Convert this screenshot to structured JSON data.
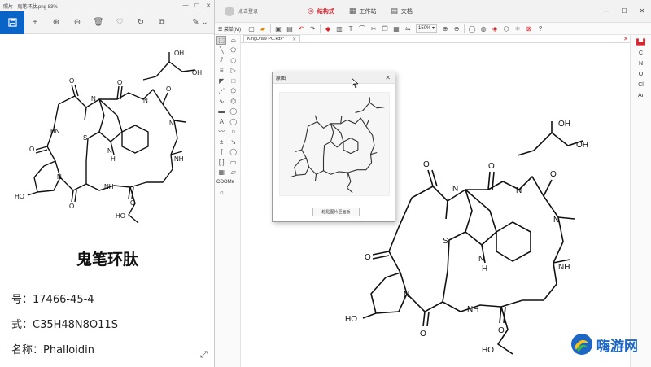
{
  "viewer": {
    "title": "照片 - 鬼笔环肽.png  83%",
    "window_controls": [
      "—",
      "☐",
      "✕"
    ],
    "toolbar": {
      "add": "+",
      "zoom_in": "⊕",
      "zoom_out": "⊖",
      "delete": "🗑",
      "favorite": "♡",
      "rotate": "↻",
      "crop": "⧉",
      "edit": "✎ ⌄"
    },
    "compound_name": "鬼笔环肽",
    "cas_line": "号：17466-45-4",
    "formula_line": "式：C35H48N8O11S",
    "english_name_line": "名称：Phalloidin",
    "resize_glyph": "⤢",
    "molecule_labels": {
      "oh": "OH",
      "ho": "HO",
      "o": "O",
      "n": "N",
      "nh": "NH",
      "hn": "HN",
      "h": "H",
      "s": "S"
    }
  },
  "kingdraw": {
    "user_login": "点击登录",
    "tabs": [
      {
        "label": "结构式",
        "icon": "◎",
        "active": true
      },
      {
        "label": "工作站",
        "icon": "▦",
        "active": false
      },
      {
        "label": "文档",
        "icon": "▤",
        "active": false
      }
    ],
    "window_controls": [
      "—",
      "☐",
      "✕"
    ],
    "menu_label": "☰ 菜单(M)",
    "zoom_level": "150% ▾",
    "document_tab": "KingDraw PC.kdx*",
    "document_tab_close": "✕",
    "left_tool_text": "COOMe",
    "right_elements": [
      "C",
      "N",
      "O",
      "Cl",
      "Ar"
    ],
    "periodic_icon": "▙▟",
    "doc_close": "✕",
    "dialog": {
      "title": "原图",
      "close": "✕",
      "button_label": "粘贴图片至画板"
    }
  },
  "watermark": {
    "text": "嗨游网"
  }
}
